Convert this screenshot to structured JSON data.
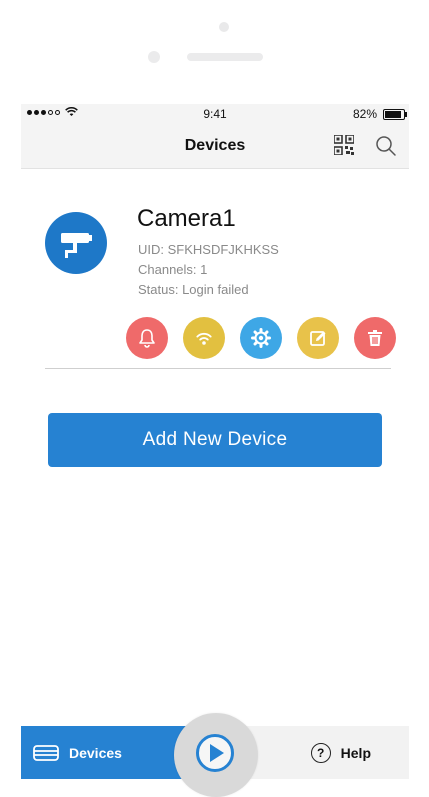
{
  "status_bar": {
    "time": "9:41",
    "battery": "82%"
  },
  "nav": {
    "title": "Devices",
    "qr_icon": "qr-code-icon",
    "search_icon": "search-icon"
  },
  "device": {
    "name": "Camera1",
    "uid": "UID: SFKHSDFJKHKSS",
    "channels": "Channels: 1",
    "status": "Status: Login failed",
    "actions": [
      {
        "name": "alarm-button",
        "icon": "bell-icon",
        "color": "#ef6a6a"
      },
      {
        "name": "wifi-button",
        "icon": "wifi-icon",
        "color": "#e2c040"
      },
      {
        "name": "settings-button",
        "icon": "gear-icon",
        "color": "#3ea7e6"
      },
      {
        "name": "edit-button",
        "icon": "edit-icon",
        "color": "#e8c24a"
      },
      {
        "name": "delete-button",
        "icon": "trash-icon",
        "color": "#ef6a6a"
      }
    ]
  },
  "add_button_label": "Add New Device",
  "tabs": {
    "devices_label": "Devices",
    "help_label": "Help",
    "help_icon_glyph": "?"
  },
  "colors": {
    "primary": "#2682d2",
    "accent_red": "#ef6a6a",
    "accent_yellow": "#e2c040",
    "accent_blue": "#3ea7e6"
  }
}
